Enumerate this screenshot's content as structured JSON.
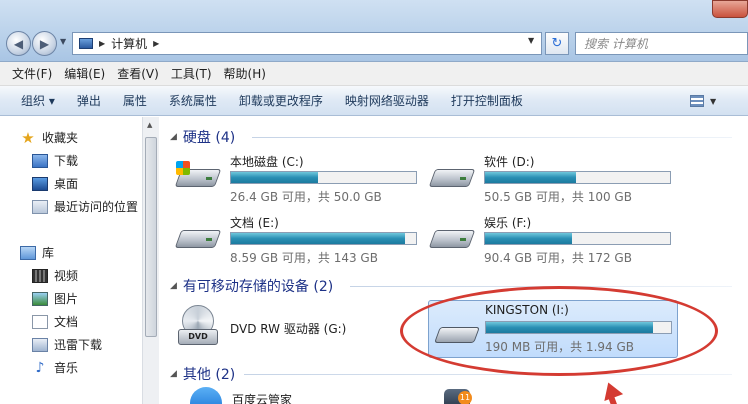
{
  "address": {
    "path": "计算机",
    "search_placeholder": "搜索 计算机"
  },
  "menubar": [
    "文件(F)",
    "编辑(E)",
    "查看(V)",
    "工具(T)",
    "帮助(H)"
  ],
  "toolbar": [
    "组织 ▾",
    "弹出",
    "属性",
    "系统属性",
    "卸载或更改程序",
    "映射网络驱动器",
    "打开控制面板"
  ],
  "sidebar": {
    "favorites": "收藏夹",
    "favorites_items": [
      "下载",
      "桌面",
      "最近访问的位置"
    ],
    "library": "库",
    "library_items": [
      "视频",
      "图片",
      "文档",
      "迅雷下载",
      "音乐"
    ]
  },
  "groups": {
    "hdd": "硬盘 (4)",
    "removable": "有可移动存储的设备 (2)",
    "other": "其他 (2)"
  },
  "drives": [
    {
      "name": "本地磁盘 (C:)",
      "info": "26.4 GB 可用，共 50.0 GB",
      "used": 0.47,
      "system": true
    },
    {
      "name": "软件 (D:)",
      "info": "50.5 GB 可用，共 100 GB",
      "used": 0.49
    },
    {
      "name": "文档 (E:)",
      "info": "8.59 GB 可用，共 143 GB",
      "used": 0.94
    },
    {
      "name": "娱乐 (F:)",
      "info": "90.4 GB 可用，共 172 GB",
      "used": 0.47
    }
  ],
  "removable": [
    {
      "name": "DVD RW 驱动器 (G:)",
      "icon_label": "DVD"
    },
    {
      "name": "KINGSTON (I:)",
      "info": "190 MB 可用，共 1.94 GB",
      "used": 0.9
    }
  ],
  "other": [
    {
      "name": "百度云管家"
    },
    {
      "name": "",
      "badge": "11"
    }
  ]
}
